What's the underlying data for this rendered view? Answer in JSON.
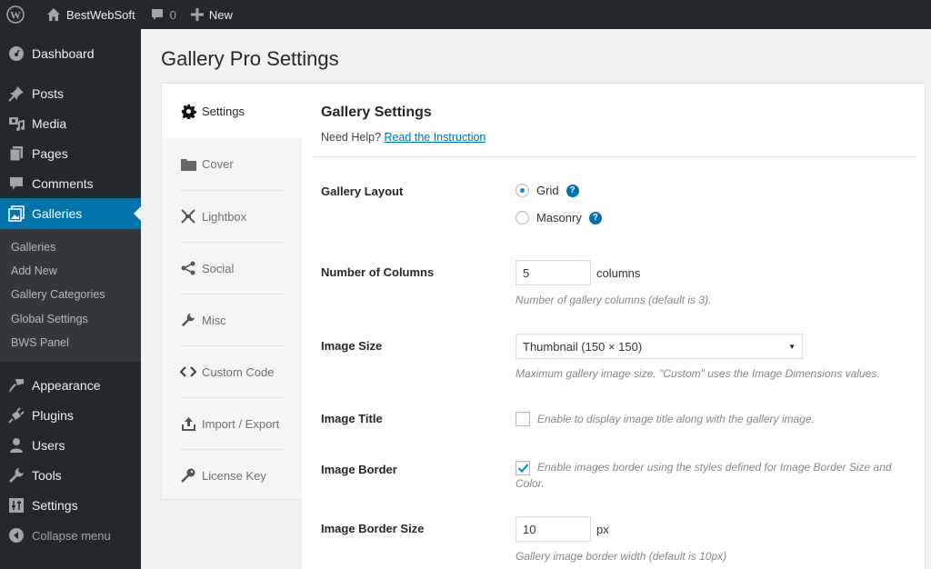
{
  "adminbar": {
    "wp_logo": "wordpress-icon",
    "site_name": "BestWebSoft",
    "comments_count": "0",
    "new_label": "New"
  },
  "sidebar": {
    "items": [
      {
        "label": "Dashboard",
        "icon": "dashboard-icon"
      },
      {
        "label": "Posts",
        "icon": "pin-icon"
      },
      {
        "label": "Media",
        "icon": "media-icon"
      },
      {
        "label": "Pages",
        "icon": "pages-icon"
      },
      {
        "label": "Comments",
        "icon": "comment-icon"
      },
      {
        "label": "Galleries",
        "icon": "gallery-icon",
        "active": true
      },
      {
        "label": "Appearance",
        "icon": "brush-icon"
      },
      {
        "label": "Plugins",
        "icon": "plug-icon"
      },
      {
        "label": "Users",
        "icon": "user-icon"
      },
      {
        "label": "Tools",
        "icon": "wrench-icon"
      },
      {
        "label": "Settings",
        "icon": "sliders-icon"
      }
    ],
    "submenu": [
      "Galleries",
      "Add New",
      "Gallery Categories",
      "Global Settings",
      "BWS Panel"
    ],
    "collapse_label": "Collapse menu"
  },
  "page": {
    "title": "Gallery Pro Settings"
  },
  "tabs": [
    {
      "label": "Settings",
      "icon": "gear-icon",
      "active": true
    },
    {
      "label": "Cover",
      "icon": "folder-icon"
    },
    {
      "label": "Lightbox",
      "icon": "expand-icon"
    },
    {
      "label": "Social",
      "icon": "share-icon"
    },
    {
      "label": "Misc",
      "icon": "wrench-icon"
    },
    {
      "label": "Custom Code",
      "icon": "code-icon"
    },
    {
      "label": "Import / Export",
      "icon": "upload-icon"
    },
    {
      "label": "License Key",
      "icon": "key-icon"
    }
  ],
  "panel": {
    "title": "Gallery Settings",
    "help_prefix": "Need Help?",
    "help_link": "Read the Instruction",
    "fields": {
      "layout": {
        "label": "Gallery Layout",
        "options": [
          "Grid",
          "Masonry"
        ],
        "selected": "Grid"
      },
      "columns": {
        "label": "Number of Columns",
        "value": "5",
        "unit": "columns",
        "description": "Number of gallery columns (default is 3)."
      },
      "image_size": {
        "label": "Image Size",
        "selected": "Thumbnail (150 × 150)",
        "description": "Maximum gallery image size. \"Custom\" uses the Image Dimensions values."
      },
      "image_title": {
        "label": "Image Title",
        "checked": false,
        "description": "Enable to display image title along with the gallery image."
      },
      "image_border": {
        "label": "Image Border",
        "checked": true,
        "description": "Enable images border using the styles defined for Image Border Size and Color."
      },
      "border_size": {
        "label": "Image Border Size",
        "value": "10",
        "unit": "px",
        "description": "Gallery image border width (default is 10px)"
      }
    }
  },
  "colors": {
    "accent": "#0073aa",
    "adminbar_bg": "#23282d",
    "submenu_bg": "#32373c"
  }
}
